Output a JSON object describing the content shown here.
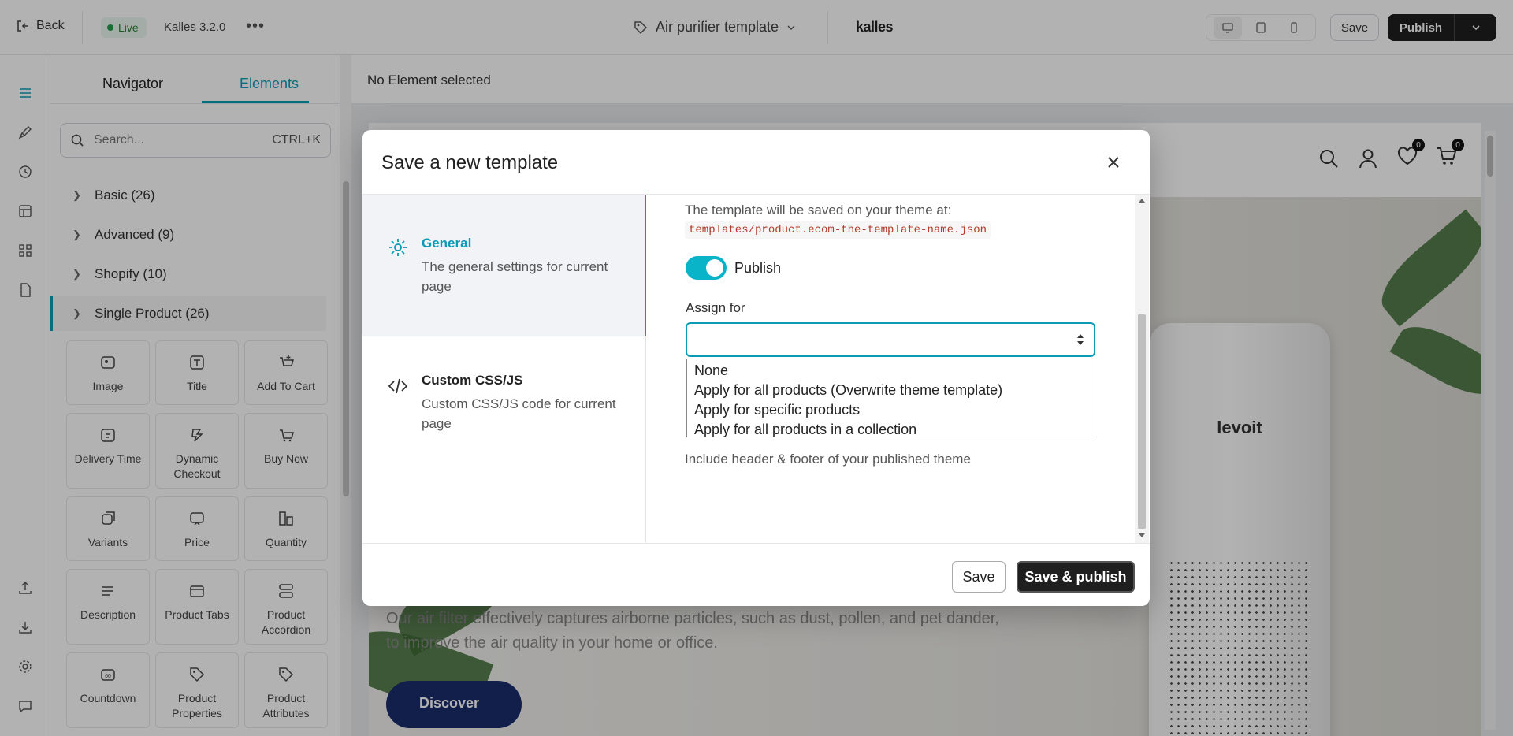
{
  "topbar": {
    "back": "Back",
    "status": "Live",
    "version": "Kalles 3.2.0",
    "template_name": "Air purifier template",
    "brand": "kalles",
    "save": "Save",
    "publish": "Publish"
  },
  "panel": {
    "tabs": [
      "Navigator",
      "Elements"
    ],
    "search_placeholder": "Search...",
    "search_shortcut": "CTRL+K",
    "categories": [
      "Basic (26)",
      "Advanced (9)",
      "Shopify (10)",
      "Single Product (26)"
    ],
    "elements": [
      "Image",
      "Title",
      "Add To Cart",
      "Delivery Time",
      "Dynamic Checkout",
      "Buy Now",
      "Variants",
      "Price",
      "Quantity",
      "Description",
      "Product Tabs",
      "Product Accordion",
      "Countdown",
      "Product Properties",
      "Product Attributes"
    ]
  },
  "canvas": {
    "status": "No Element selected",
    "wishlist_count": "0",
    "cart_count": "0",
    "product_logo": "levoit",
    "hero_text": "Our air filter effectively captures airborne particles, such as dust, pollen, and pet dander, to improve the air quality in your home or office.",
    "cta": "Discover"
  },
  "modal": {
    "title": "Save a new template",
    "nav": [
      {
        "title": "General",
        "desc": "The general settings for current page"
      },
      {
        "title": "Custom CSS/JS",
        "desc": "Custom CSS/JS code for current page"
      }
    ],
    "saved_at_label": "The template will be saved on your theme at:",
    "path": "templates/product.ecom-the-template-name.json",
    "publish_toggle_label": "Publish",
    "publish_on": true,
    "assign_label": "Assign for",
    "assign_value": "",
    "assign_options": [
      "None",
      "Apply for all products (Overwrite theme template)",
      "Apply for specific products",
      "Apply for all products in a collection"
    ],
    "include_text": "Include header & footer of your published theme",
    "save": "Save",
    "save_publish": "Save & publish"
  },
  "colors": {
    "accent": "#0a9bb5",
    "toggle": "#0ab4c8",
    "dark_button": "#1f1f1f",
    "live": "#22a04b"
  }
}
